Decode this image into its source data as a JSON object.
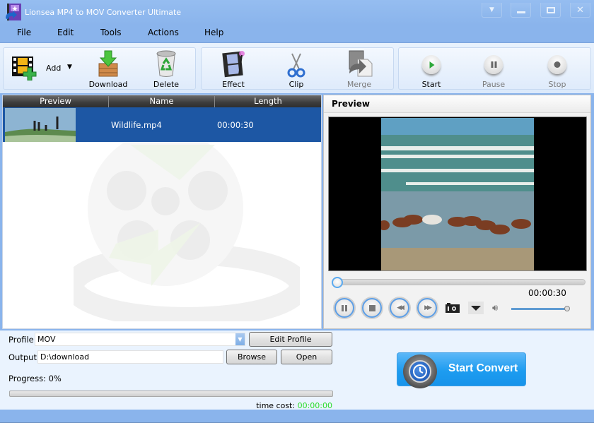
{
  "window": {
    "title": "Lionsea MP4 to MOV Converter Ultimate",
    "controls": [
      "menu-dropdown",
      "minimize",
      "maximize",
      "close"
    ]
  },
  "menu": {
    "items": [
      {
        "label": "File"
      },
      {
        "label": "Edit"
      },
      {
        "label": "Tools"
      },
      {
        "label": "Actions"
      },
      {
        "label": "Help"
      }
    ]
  },
  "toolbar": {
    "add": {
      "label": "Add",
      "icon": "film-add-icon"
    },
    "download": {
      "label": "Download",
      "icon": "download-box-icon"
    },
    "delete": {
      "label": "Delete",
      "icon": "recycle-bin-icon"
    },
    "effect": {
      "label": "Effect",
      "icon": "film-effect-icon"
    },
    "clip": {
      "label": "Clip",
      "icon": "scissors-icon"
    },
    "merge": {
      "label": "Merge",
      "icon": "merge-doc-icon",
      "enabled": false
    },
    "start": {
      "label": "Start",
      "icon": "play-icon"
    },
    "pause": {
      "label": "Pause",
      "icon": "pause-icon",
      "enabled": false
    },
    "stop": {
      "label": "Stop",
      "icon": "stop-icon",
      "enabled": false
    }
  },
  "file_list": {
    "columns": [
      "Preview",
      "Name",
      "Length"
    ],
    "rows": [
      {
        "name": "Wildlife.mp4",
        "length": "00:00:30",
        "selected": true
      }
    ]
  },
  "preview": {
    "title": "Preview",
    "time": "00:00:30",
    "seek_position": 0,
    "volume": 1.0
  },
  "settings": {
    "profile_label": "Profile:",
    "profile_value": "MOV",
    "edit_profile_label": "Edit Profile",
    "output_label": "Output:",
    "output_value": "D:\\download",
    "browse_label": "Browse",
    "open_label": "Open",
    "progress_label": "Progress: 0%",
    "progress_value": 0,
    "time_cost_label": "time cost:",
    "time_cost_value": "00:00:00"
  },
  "start_convert": {
    "label": "Start Convert"
  },
  "colors": {
    "titlebar": "#8ab4ec",
    "selection": "#1d57a4",
    "convert_button": "#1d9cf0",
    "time_cost": "#2bdc2b"
  }
}
